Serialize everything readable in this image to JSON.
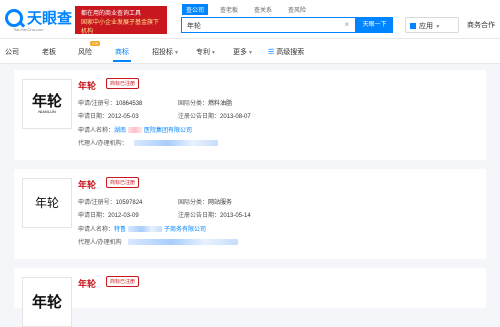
{
  "header": {
    "logo_name": "天眼查",
    "logo_sub": "TianYanCha.com",
    "banner_line1": "都在用的商业查询工具",
    "banner_line2": "国家中小企业发展子基金旗下机构",
    "search_tabs": [
      "查公司",
      "查老板",
      "查关系",
      "查风险"
    ],
    "search_value": "年轮",
    "clear_icon": "×",
    "search_button": "天眼一下",
    "apps_label": "应用",
    "business": "商务合作"
  },
  "nav": {
    "items": [
      {
        "label": "公司"
      },
      {
        "label": "老板"
      },
      {
        "label": "风险"
      },
      {
        "label": "商标"
      },
      {
        "label": "招投标"
      },
      {
        "label": "专利"
      },
      {
        "label": "更多"
      },
      {
        "label": "高级搜索"
      }
    ],
    "vip_badge": "VIP"
  },
  "results": [
    {
      "logo_text": "年轮",
      "logo_sub": "NIANLUN",
      "title": "年轮",
      "status": "商标已注册",
      "reg_no_label": "申请/注册号：",
      "reg_no": "10864538",
      "class_label": "国际分类：",
      "class": "燃料油脂",
      "apply_date_label": "申请日期：",
      "apply_date": "2012-05-03",
      "pub_date_label": "注册公告日期：",
      "pub_date": "2013-08-07",
      "applicant_label": "申请人名称：",
      "applicant_prefix": "湖南",
      "applicant_suffix": "医院集团有限公司",
      "agent_label": "代理人/办理机构："
    },
    {
      "logo_text": "年轮",
      "logo_sub": "",
      "title": "年轮",
      "status": "商标已注册",
      "reg_no_label": "申请/注册号：",
      "reg_no": "10597824",
      "class_label": "国际分类：",
      "class": "网站服务",
      "apply_date_label": "申请日期：",
      "apply_date": "2012-03-09",
      "pub_date_label": "注册公告日期：",
      "pub_date": "2013-05-14",
      "applicant_label": "申请人名称：",
      "applicant_prefix": "特鲁",
      "applicant_suffix": "子商务有限公司",
      "agent_label": "代理人/办理机构"
    },
    {
      "logo_text": "年轮",
      "title": "年轮",
      "status": "商标已注册"
    }
  ],
  "colors": {
    "brand_blue": "#0084ff",
    "trademark_red": "#c8171e"
  }
}
